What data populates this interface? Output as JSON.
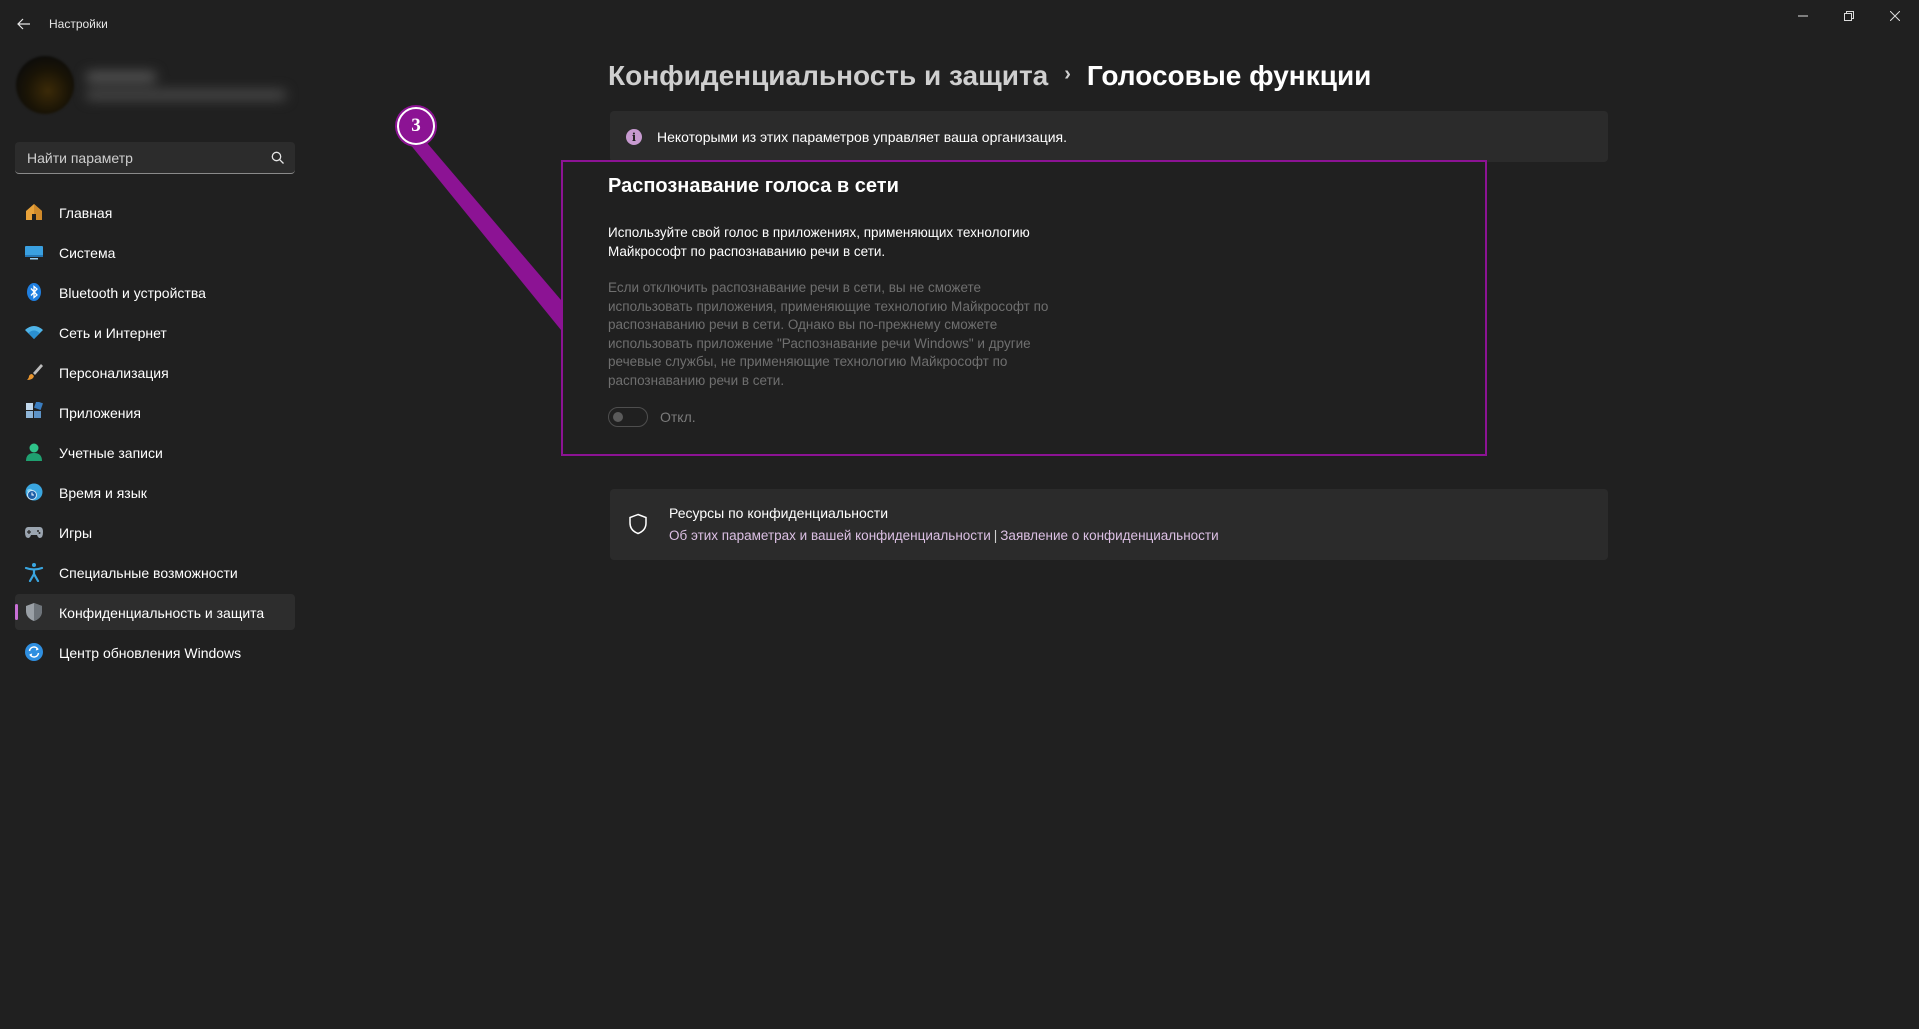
{
  "window": {
    "title": "Настройки"
  },
  "search": {
    "placeholder": "Найти параметр"
  },
  "sidebar": {
    "items": [
      {
        "label": "Главная",
        "icon": "home-icon",
        "active": false
      },
      {
        "label": "Система",
        "icon": "display-icon",
        "active": false
      },
      {
        "label": "Bluetooth и устройства",
        "icon": "bluetooth-icon",
        "active": false
      },
      {
        "label": "Сеть и Интернет",
        "icon": "wifi-icon",
        "active": false
      },
      {
        "label": "Персонализация",
        "icon": "brush-icon",
        "active": false
      },
      {
        "label": "Приложения",
        "icon": "apps-icon",
        "active": false
      },
      {
        "label": "Учетные записи",
        "icon": "person-icon",
        "active": false
      },
      {
        "label": "Время и язык",
        "icon": "globe-clock-icon",
        "active": false
      },
      {
        "label": "Игры",
        "icon": "gamepad-icon",
        "active": false
      },
      {
        "label": "Специальные возможности",
        "icon": "accessibility-icon",
        "active": false
      },
      {
        "label": "Конфиденциальность и защита",
        "icon": "shield-icon",
        "active": true
      },
      {
        "label": "Центр обновления Windows",
        "icon": "update-icon",
        "active": false
      }
    ]
  },
  "breadcrumb": {
    "parent": "Конфиденциальность и защита",
    "separator": "›",
    "current": "Голосовые функции"
  },
  "org_notice": {
    "text": "Некоторыми из этих параметров управляет ваша организация."
  },
  "voice_section": {
    "title": "Распознавание голоса в сети",
    "description": "Используйте свой голос в приложениях, применяющих технологию Майкрософт по распознаванию речи в сети.",
    "disabled_note": "Если отключить распознавание речи в сети, вы не сможете использовать приложения, применяющие технологию Майкрософт по распознаванию речи в сети. Однако вы по-прежнему сможете использовать приложение \"Распознавание речи Windows\" и другие речевые службы, не применяющие технологию Майкрософт по распознаванию речи в сети.",
    "toggle_state": "Откл.",
    "toggle_on": false
  },
  "annotation": {
    "step_number": "3",
    "color": "#8c1394"
  },
  "privacy_resources": {
    "title": "Ресурсы по конфиденциальности",
    "link1": "Об этих параметрах и вашей конфиденциальности",
    "separator": "|",
    "link2": "Заявление о конфиденциальности"
  },
  "colors": {
    "background": "#202020",
    "card": "#2b2b2b",
    "accent": "#c86fd6",
    "link": "#dcc0e4"
  }
}
